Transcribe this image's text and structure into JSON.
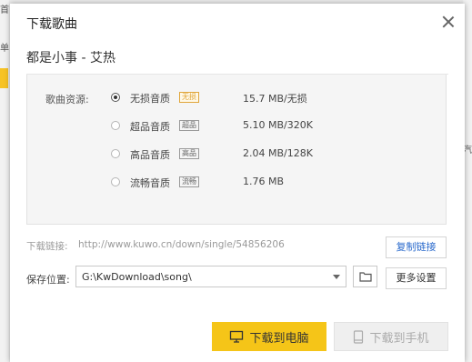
{
  "background": {
    "hint_top": "首",
    "hint_mid": "单",
    "hint_right": "汽"
  },
  "dialog": {
    "title": "下载歌曲",
    "close_icon": "close-icon",
    "song_title": "都是小事 - 艾热"
  },
  "quality": {
    "label": "歌曲资源:",
    "options": [
      {
        "label": "无损音质",
        "badge": "无损",
        "size": "15.7 MB/无损",
        "selected": true
      },
      {
        "label": "超品音质",
        "badge": "超品",
        "size": "5.10 MB/320K",
        "selected": false
      },
      {
        "label": "高品音质",
        "badge": "高品",
        "size": "2.04 MB/128K",
        "selected": false
      },
      {
        "label": "流畅音质",
        "badge": "流畅",
        "size": "1.76 MB",
        "selected": false
      }
    ]
  },
  "link": {
    "label": "下载链接:",
    "url": "http://www.kuwo.cn/down/single/54856206",
    "copy_button": "复制链接"
  },
  "save": {
    "label": "保存位置:",
    "path": "G:\\KwDownload\\song\\",
    "folder_icon": "folder-icon",
    "more_button": "更多设置"
  },
  "actions": {
    "download_pc": "下载到电脑",
    "download_phone": "下载到手机",
    "pc_icon": "monitor-icon",
    "phone_icon": "phone-icon"
  },
  "colors": {
    "primary_button": "#f5c518",
    "badge_lossless": "#e0a63b",
    "link_blue": "#2a6acc"
  }
}
